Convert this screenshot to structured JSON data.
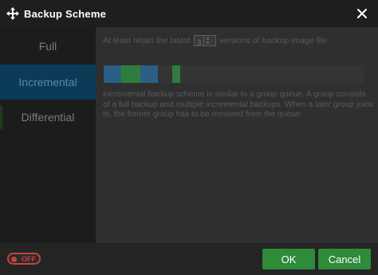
{
  "window": {
    "title": "Backup Scheme",
    "app_icon": "move-arrows-icon",
    "close_icon": "close-icon"
  },
  "sidebar": {
    "items": [
      {
        "label": "Full",
        "active": false
      },
      {
        "label": "Incremental",
        "active": true
      },
      {
        "label": "Differential",
        "active": false
      }
    ]
  },
  "content": {
    "retain_prefix": "At least retain the latest",
    "retain_value": "3",
    "retain_suffix": "versions of backup image file.",
    "description": "Incremental backup scheme is similar to a group queue. A group consists of a full backup and multiple incremental backups. When a later group joins in, the former group has to be removed from the queue.",
    "scheme_bar": {
      "segments": [
        {
          "color": "#2b5f86"
        },
        {
          "color": "#2f7d3c"
        },
        {
          "color": "#2f7d3c"
        },
        {
          "color": "#2b5f86"
        },
        {
          "color": "#343434"
        },
        {
          "color": "#2f7d3c"
        }
      ]
    }
  },
  "footer": {
    "toggle_label": "OFF",
    "ok_label": "OK",
    "cancel_label": "Cancel"
  },
  "colors": {
    "accent_green": "#2e8b3a",
    "toggle_red": "#c5423f",
    "active_blue": "#0c3b58"
  }
}
